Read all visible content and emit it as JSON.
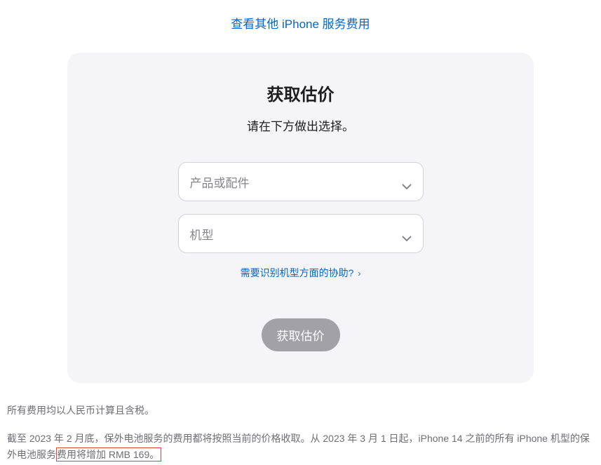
{
  "topLink": "查看其他 iPhone 服务费用",
  "card": {
    "title": "获取估价",
    "subtitle": "请在下方做出选择。",
    "select1": {
      "placeholder": "产品或配件"
    },
    "select2": {
      "placeholder": "机型"
    },
    "helpLink": "需要识别机型方面的协助?",
    "submitLabel": "获取估价"
  },
  "footnote1": "所有费用均以人民币计算且含税。",
  "footnote2_part1": "截至 2023 年 2 月底，保外电池服务的费用都将按照当前的价格收取。从 2023 年 3 月 1 日起，iPhone 14 之前的所有 iPhone 机型的保外电池服务",
  "footnote2_highlight": "费用将增加 RMB 169。"
}
